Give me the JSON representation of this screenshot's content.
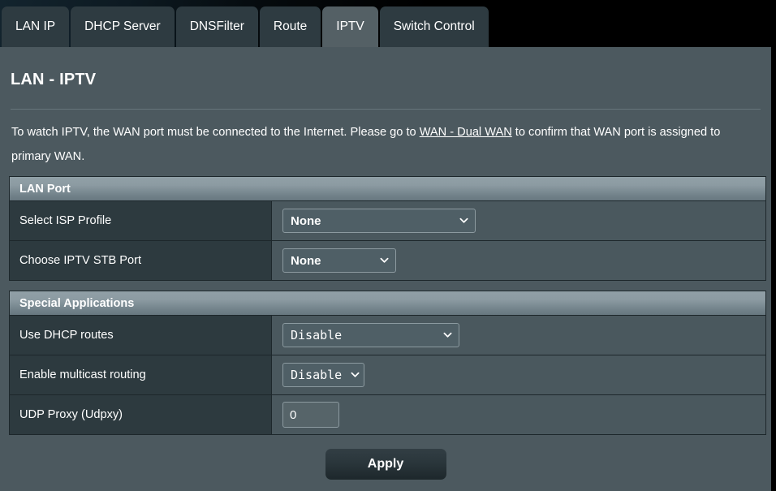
{
  "tabs": [
    {
      "label": "LAN IP",
      "active": false
    },
    {
      "label": "DHCP Server",
      "active": false
    },
    {
      "label": "DNSFilter",
      "active": false
    },
    {
      "label": "Route",
      "active": false
    },
    {
      "label": "IPTV",
      "active": true
    },
    {
      "label": "Switch Control",
      "active": false
    }
  ],
  "page": {
    "title": "LAN - IPTV",
    "description_before": "To watch IPTV, the WAN port must be connected to the Internet. Please go to ",
    "description_link": "WAN - Dual WAN",
    "description_after": " to confirm that WAN port is assigned to primary WAN."
  },
  "sections": [
    {
      "id": "lan-port",
      "heading": "LAN Port",
      "rows": [
        {
          "label": "Select ISP Profile",
          "control": "select",
          "value": "None"
        },
        {
          "label": "Choose IPTV STB Port",
          "control": "select",
          "value": "None"
        }
      ]
    },
    {
      "id": "special-applications",
      "heading": "Special Applications",
      "rows": [
        {
          "label": "Use DHCP routes",
          "control": "select",
          "value": "Disable"
        },
        {
          "label": "Enable multicast routing",
          "control": "select",
          "value": "Disable"
        },
        {
          "label": "UDP Proxy (Udpxy)",
          "control": "text",
          "value": "0"
        }
      ]
    }
  ],
  "footer": {
    "apply_label": "Apply"
  },
  "icons": {
    "chevron_down": "chevron-down-icon"
  },
  "colors": {
    "page_background": "#000000",
    "panel_background": "#4c595f",
    "tab_inactive": "#2e3b41",
    "tab_active": "#546065",
    "section_header_top": "#91a0a7",
    "section_header_bottom": "#687880",
    "cell_label_background": "#2d3a3f",
    "cell_value_background": "#4a585e",
    "control_border": "#8c9aa0",
    "text": "#ffffff"
  }
}
